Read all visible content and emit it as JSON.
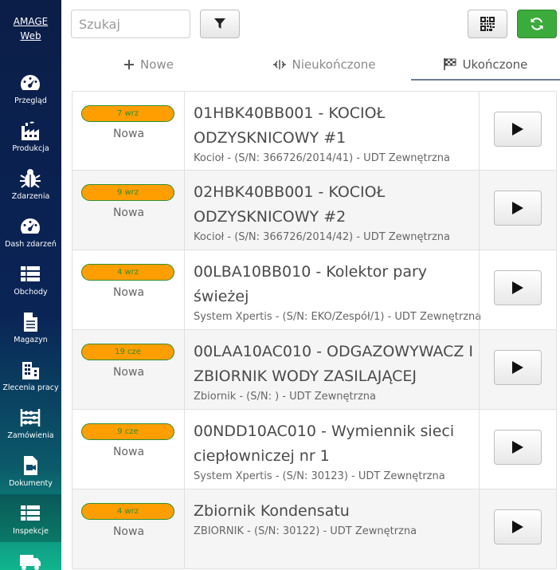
{
  "brand": {
    "line1": "AMAGE",
    "line2": "Web"
  },
  "sidebar": {
    "items": [
      {
        "label": "Przegląd",
        "icon": "dashboard-icon"
      },
      {
        "label": "Produkcja",
        "icon": "factory-icon"
      },
      {
        "label": "Zdarzenia",
        "icon": "bug-icon"
      },
      {
        "label": "Dash zdarzeń",
        "icon": "gauge-icon"
      },
      {
        "label": "Obchody",
        "icon": "list-icon"
      },
      {
        "label": "Magazyn",
        "icon": "document-icon"
      },
      {
        "label": "Zlecenia pracy",
        "icon": "building-icon"
      },
      {
        "label": "Zamówienia",
        "icon": "abacus-icon"
      },
      {
        "label": "Dokumenty",
        "icon": "video-file-icon"
      },
      {
        "label": "Inspekcje",
        "icon": "table-icon"
      },
      {
        "label": "",
        "icon": "truck-icon"
      }
    ],
    "active_index": 9
  },
  "search": {
    "placeholder": "Szukaj"
  },
  "tabs": [
    {
      "label": "Nowe",
      "icon": "plus-icon"
    },
    {
      "label": "Nieukończone",
      "icon": "split-icon"
    },
    {
      "label": "Ukończone",
      "icon": "checkered-flag-icon"
    }
  ],
  "active_tab": 2,
  "colors": {
    "badge_bg": "#ff9e00",
    "badge_text": "#2f8f2f",
    "refresh_btn": "#3bab3b",
    "sidebar_top": "#0b1e48",
    "sidebar_bottom": "#10b58e"
  },
  "rows": [
    {
      "date": "7 wrz",
      "status": "Nowa",
      "title": "01HBK40BB001 - KOCIOŁ ODZYSKNICOWY #1",
      "subtitle": "Kocioł - (S/N: 366726/2014/41) - UDT Zewnętrzna"
    },
    {
      "date": "9 wrz",
      "status": "Nowa",
      "title": "02HBK40BB001 - KOCIOŁ ODZYSKNICOWY #2",
      "subtitle": "Kocioł - (S/N: 366726/2014/42) - UDT Zewnętrzna"
    },
    {
      "date": "4 wrz",
      "status": "Nowa",
      "title": "00LBA10BB010 - Kolektor pary świeżej",
      "subtitle": "System Xpertis - (S/N: EKO/Zespół/1) - UDT Zewnętrzna"
    },
    {
      "date": "19 cze",
      "status": "Nowa",
      "title": "00LAA10AC010 - ODGAZOWYWACZ I ZBIORNIK WODY ZASILAJĄCEJ",
      "subtitle": "Zbiornik - (S/N: ) - UDT Zewnętrzna"
    },
    {
      "date": "9 cze",
      "status": "Nowa",
      "title": "00NDD10AC010 - Wymiennik sieci ciepłowniczej nr 1",
      "subtitle": "System Xpertis - (S/N: 30123) - UDT Zewnętrzna"
    },
    {
      "date": "4 wrz",
      "status": "Nowa",
      "title": "Zbiornik Kondensatu",
      "subtitle": "ZBIORNIK - (S/N: 30122) - UDT Zewnętrzna"
    }
  ]
}
